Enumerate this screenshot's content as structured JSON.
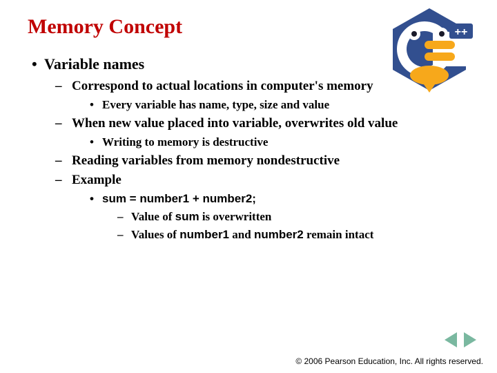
{
  "title": "Memory Concept",
  "logo": {
    "badge": "++"
  },
  "bullets": {
    "l1_0": "Variable names",
    "l2_0": "Correspond to actual locations in computer's memory",
    "l3_0": "Every variable has name, type, size and value",
    "l2_1": "When new value placed into variable, overwrites old value",
    "l3_1": "Writing to memory is destructive",
    "l2_2": "Reading variables from memory nondestructive",
    "l2_3": "Example",
    "l3_2": "sum = number1 + number2;",
    "l4_0_a": "Value of ",
    "l4_0_b": "sum",
    "l4_0_c": " is overwritten",
    "l4_1_a": "Values of ",
    "l4_1_b": "number1",
    "l4_1_c": " and ",
    "l4_1_d": "number2",
    "l4_1_e": " remain intact"
  },
  "copyright": "© 2006 Pearson Education, Inc.  All rights reserved."
}
